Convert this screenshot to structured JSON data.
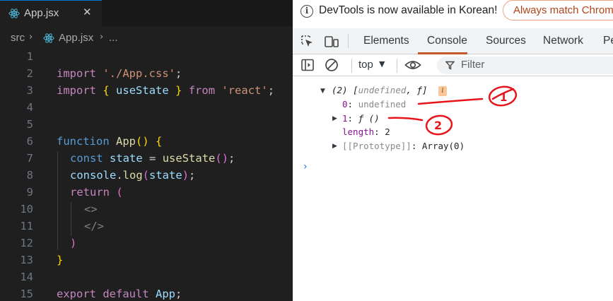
{
  "editor": {
    "tab": {
      "label": "App.jsx",
      "close": "✕"
    },
    "breadcrumb": {
      "folder": "src",
      "file": "App.jsx",
      "more": "..."
    },
    "lines": [
      {
        "num": "1",
        "tokens": []
      },
      {
        "num": "2",
        "tokens": [
          [
            "kw2",
            "import"
          ],
          [
            "",
            "' "
          ],
          [
            "str",
            "'./App.css'"
          ],
          [
            "",
            ";"
          ]
        ]
      },
      {
        "num": "3",
        "tokens": [
          [
            "kw2",
            "import"
          ],
          [
            "",
            ""
          ],
          [
            "br1",
            "{"
          ],
          [
            "",
            ""
          ],
          [
            "var",
            "useState"
          ],
          [
            "",
            ""
          ],
          [
            "br1",
            "}"
          ],
          [
            "",
            ""
          ],
          [
            "kw2",
            "from"
          ],
          [
            "",
            ""
          ],
          [
            "str",
            "'react'"
          ],
          [
            "",
            ";"
          ]
        ]
      },
      {
        "num": "4",
        "tokens": []
      },
      {
        "num": "5",
        "tokens": []
      },
      {
        "num": "6",
        "tokens": [
          [
            "kw",
            "function"
          ],
          [
            "",
            ""
          ],
          [
            "fn",
            "App"
          ],
          [
            "br1",
            "()"
          ],
          [
            "",
            ""
          ],
          [
            "br1",
            "{"
          ]
        ]
      },
      {
        "num": "7",
        "tokens": [
          [
            "kw",
            "const"
          ],
          [
            "",
            ""
          ],
          [
            "var",
            "state"
          ],
          [
            "",
            ""
          ],
          [
            "",
            "="
          ],
          [
            "",
            ""
          ],
          [
            "fn",
            "useState"
          ],
          [
            "br2",
            "()"
          ],
          [
            "",
            ";"
          ]
        ]
      },
      {
        "num": "8",
        "tokens": [
          [
            "var",
            "console"
          ],
          [
            "",
            "."
          ],
          [
            "fn",
            "log"
          ],
          [
            "br2",
            "("
          ],
          [
            "var",
            "state"
          ],
          [
            "br2",
            ")"
          ],
          [
            "",
            ";"
          ]
        ]
      },
      {
        "num": "9",
        "tokens": [
          [
            "kw2",
            "return"
          ],
          [
            "",
            ""
          ],
          [
            "br2",
            "("
          ]
        ]
      },
      {
        "num": "10",
        "tokens": [
          [
            "tag",
            "<>"
          ]
        ]
      },
      {
        "num": "11",
        "tokens": [
          [
            "tag",
            "</>"
          ]
        ]
      },
      {
        "num": "12",
        "tokens": [
          [
            "br2",
            ")"
          ]
        ]
      },
      {
        "num": "13",
        "tokens": [
          [
            "br1",
            "}"
          ]
        ]
      },
      {
        "num": "14",
        "tokens": []
      },
      {
        "num": "15",
        "tokens": [
          [
            "kw2",
            "export"
          ],
          [
            "",
            ""
          ],
          [
            "kw2",
            "default"
          ],
          [
            "",
            ""
          ],
          [
            "var",
            "App"
          ],
          [
            "",
            ";"
          ]
        ]
      }
    ]
  },
  "devtools": {
    "banner": {
      "text": "DevTools is now available in Korean!",
      "button": "Always match Chrome"
    },
    "tabs": [
      "Elements",
      "Console",
      "Sources",
      "Network",
      "Pe"
    ],
    "active_tab": "Console",
    "toolbar": {
      "context": "top",
      "filter_placeholder": "Filter"
    },
    "console": {
      "summary_prefix": "(2) [",
      "summary_undefined": "undefined",
      "summary_sep": ", ",
      "summary_f": "ƒ",
      "summary_suffix": "]",
      "info_badge": "i",
      "row0_index": "0",
      "row0_value": "undefined",
      "row1_index": "1",
      "row1_value": "ƒ ()",
      "length_key": "length",
      "length_value": "2",
      "proto_key": "[[Prototype]]",
      "proto_value": "Array(0)",
      "prompt": "›"
    },
    "annotations": [
      "1",
      "2"
    ]
  },
  "colors": {
    "editor_bg": "#1f1f1f",
    "accent_tab": "#c35a2b",
    "annotation_red": "#e8141c"
  }
}
